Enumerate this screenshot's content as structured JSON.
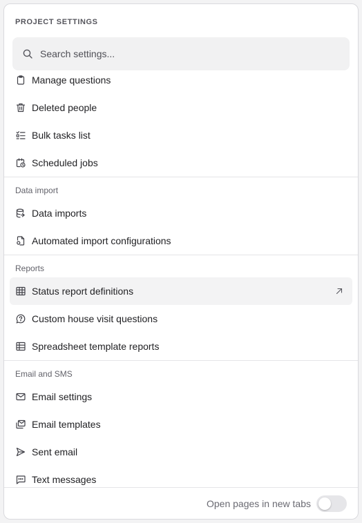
{
  "header": {
    "title": "PROJECT SETTINGS"
  },
  "search": {
    "placeholder": "Search settings..."
  },
  "sections": [
    {
      "header": "",
      "items": [
        {
          "label": "Manage questions",
          "icon": "clipboard-icon"
        },
        {
          "label": "Deleted people",
          "icon": "trash-icon"
        },
        {
          "label": "Bulk tasks list",
          "icon": "list-checks-icon"
        },
        {
          "label": "Scheduled jobs",
          "icon": "calendar-clock-icon"
        }
      ]
    },
    {
      "header": "Data import",
      "items": [
        {
          "label": "Data imports",
          "icon": "database-import-icon"
        },
        {
          "label": "Automated import configurations",
          "icon": "file-cog-icon"
        }
      ]
    },
    {
      "header": "Reports",
      "items": [
        {
          "label": "Status report definitions",
          "icon": "table-icon",
          "active": true
        },
        {
          "label": "Custom house visit questions",
          "icon": "message-question-icon"
        },
        {
          "label": "Spreadsheet template reports",
          "icon": "table-icon"
        }
      ]
    },
    {
      "header": "Email and SMS",
      "items": [
        {
          "label": "Email settings",
          "icon": "mail-icon"
        },
        {
          "label": "Email templates",
          "icon": "mail-stack-icon"
        },
        {
          "label": "Sent email",
          "icon": "send-icon"
        },
        {
          "label": "Text messages",
          "icon": "message-dots-icon"
        }
      ]
    }
  ],
  "footer": {
    "toggle_label": "Open pages in new tabs",
    "toggle_on": false
  },
  "colors": {
    "accent_bg": "#f3f3f4",
    "border": "#e4e4e7",
    "text": "#1f1f22",
    "muted": "#62626a"
  }
}
